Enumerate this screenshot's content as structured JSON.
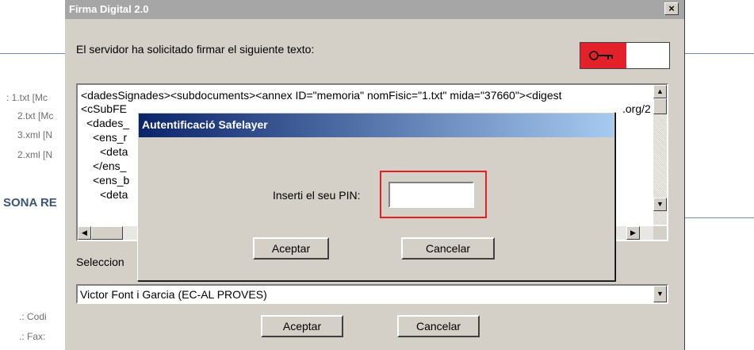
{
  "background": {
    "list_items": [
      ": 1.txt [Mc",
      "2.txt [Mc",
      "3.xml [N",
      "2.xml [N"
    ],
    "section_heading": "SONA RE",
    "footer_items": [
      ".: Codi",
      ".: Fax:"
    ]
  },
  "window": {
    "title": "Firma Digital 2.0",
    "close_label": "×",
    "prompt": "El servidor ha solicitado firmar el siguiente texto:",
    "key_icon_text": "⊙━┳",
    "text_lines": [
      "<dadesSignades><subdocuments><annex ID=\"memoria\" nomFisic=\"1.txt\" mida=\"37660\"><digest",
      "<cSubFE",
      "<dades_",
      "<ens_r",
      "<deta",
      "</ens_",
      "<ens_b",
      "<deta"
    ],
    "text_line2_tail": ".org/2",
    "select_label": "Seleccion",
    "certificate_value": "Victor Font i Garcia (EC-AL PROVES)",
    "accept_label": "Aceptar",
    "cancel_label": "Cancelar",
    "scroll_up": "▲",
    "scroll_down": "▼",
    "scroll_left": "◀",
    "scroll_right": "▶",
    "combo_arrow": "▼"
  },
  "dialog": {
    "title": "Autentificació Safelayer",
    "pin_label": "Inserti el seu PIN:",
    "pin_value": "",
    "accept_label": "Aceptar",
    "cancel_label": "Cancelar"
  },
  "colors": {
    "dialog_title_start": "#0a246a",
    "dialog_title_end": "#a6caf0",
    "highlight": "#e3201f",
    "key_red": "#e4202a"
  }
}
